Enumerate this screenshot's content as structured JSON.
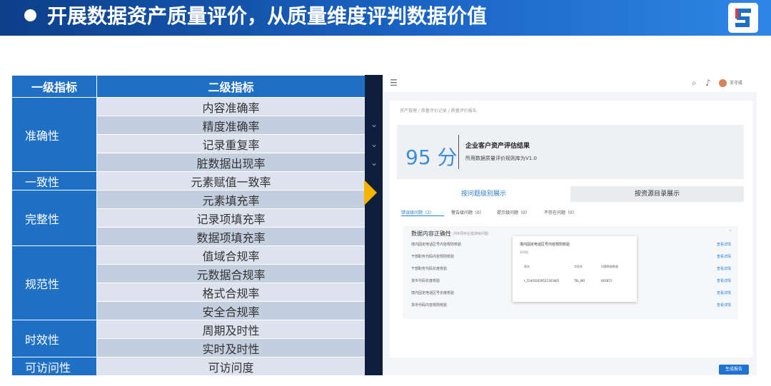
{
  "banner": {
    "title": "开展数据资产质量评价，从质量维度评判数据价值"
  },
  "table": {
    "col1_header": "一级指标",
    "col2_header": "二级指标",
    "groups": [
      {
        "name": "准确性",
        "items": [
          "内容准确率",
          "精度准确率",
          "记录重复率",
          "脏数据出现率"
        ]
      },
      {
        "name": "一致性",
        "items": [
          "元素赋值一致率"
        ]
      },
      {
        "name": "完整性",
        "items": [
          "元素填充率",
          "记录项填充率",
          "数据项填充率"
        ]
      },
      {
        "name": "规范性",
        "items": [
          "值域合规率",
          "元数据合规率",
          "格式合规率",
          "安全合规率"
        ]
      },
      {
        "name": "时效性",
        "items": [
          "周期及时性",
          "实时及时性"
        ]
      },
      {
        "name": "可访问性",
        "items": [
          "可访问度"
        ]
      }
    ]
  },
  "app": {
    "user_name": "王守成",
    "breadcrumb": "资产管理 / 质量评价记录 / 质量评价报告",
    "score": "95 分",
    "result_title": "企业客户资产评估结果",
    "rule_version": "所用数据质量评价规则库为V1.0",
    "view_tabs": [
      "按问题级别展示",
      "按资源目录展示"
    ],
    "issue_tabs": [
      "错误级问题（3）",
      "警告级问题（0）",
      "提示级问题（0）",
      "不存在问题（0）"
    ],
    "rules_header": "数据内容正确性",
    "rules_header_sub": "/共6项存在错误级问题",
    "rules": [
      "境内固定电话区号内容规则校验",
      "干部职务代码内容规则校验",
      "干部职务代码长度校验",
      "货币代码长度校验",
      "境内固定电话区号长度校验",
      "货币代码内容规则校验"
    ],
    "rule_link": "查看详情",
    "popup_title": "境内固定电话区号内容规则校验",
    "popup_sub": "表明细",
    "popup_headers": [
      "表名",
      "字段名",
      "问题数据数量"
    ],
    "popup_row": [
      "t_154032629521303465",
      "TEL_NO",
      "665872"
    ],
    "generate_button": "生成报告"
  }
}
